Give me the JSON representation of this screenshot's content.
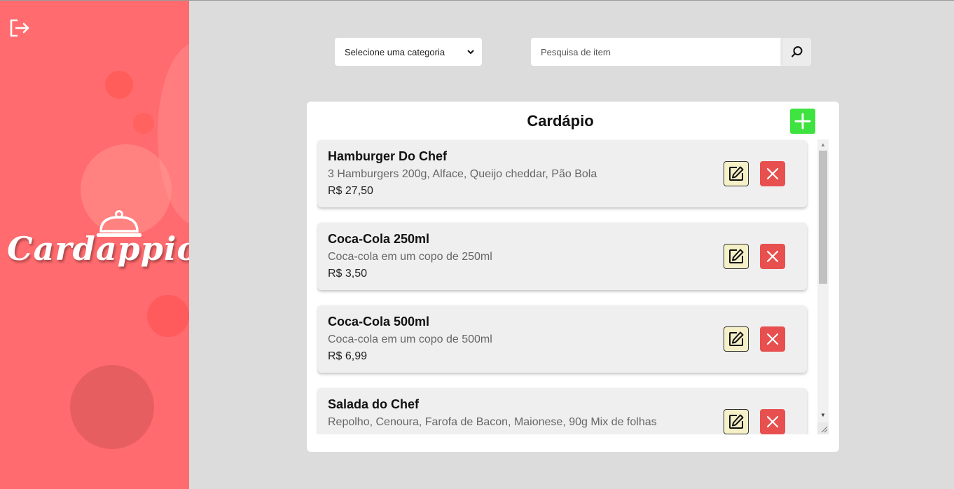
{
  "app": {
    "logo_text": "Cardappio"
  },
  "filters": {
    "category_selected": "Selecione uma categoria",
    "search_placeholder": "Pesquisa de item"
  },
  "menu": {
    "title": "Cardápio",
    "items": [
      {
        "name": "Hamburger Do Chef",
        "description": "3 Hamburgers 200g, Alface, Queijo cheddar, Pão Bola",
        "price": "R$ 27,50"
      },
      {
        "name": "Coca-Cola 250ml",
        "description": "Coca-cola em um copo de 250ml",
        "price": "R$ 3,50"
      },
      {
        "name": "Coca-Cola 500ml",
        "description": "Coca-cola em um copo de 500ml",
        "price": "R$ 6,99"
      },
      {
        "name": "Salada do Chef",
        "description": "Repolho, Cenoura, Farofa de Bacon, Maionese, 90g Mix de folhas",
        "price": ""
      }
    ]
  },
  "icons": {
    "logout": "logout-icon",
    "search": "search-icon",
    "add": "plus-icon",
    "edit": "edit-icon",
    "delete": "close-icon",
    "cloche": "cloche-icon"
  },
  "colors": {
    "sidebar": "#ff6b6e",
    "add_button": "#3fe33f",
    "edit_button": "#f6f0c8",
    "delete_button": "#e85050",
    "background": "#dcdcdc"
  }
}
